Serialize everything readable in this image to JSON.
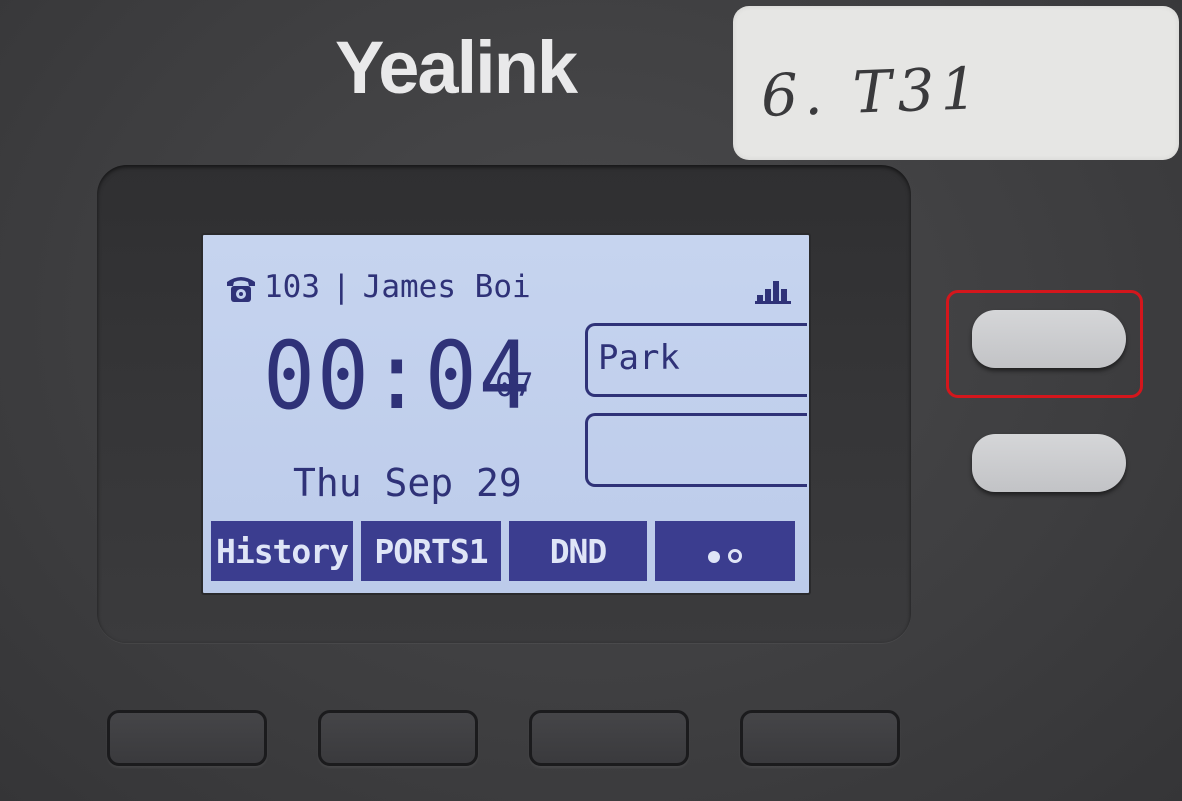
{
  "brand": {
    "logo_text": "Yealink"
  },
  "sticker": {
    "label": "6. T31"
  },
  "screen": {
    "status": {
      "phone_icon": "phone-icon",
      "line_number": "103",
      "separator": "|",
      "user_name": "James Boi",
      "signal_icon": "signal-icon"
    },
    "call_timer": "00:04",
    "call_timer_seconds": "07",
    "date": "Thu Sep 29",
    "line_keys": [
      {
        "label": "Park"
      },
      {
        "label": ""
      }
    ],
    "softkeys": [
      {
        "label": "History"
      },
      {
        "label": "PORTS1"
      },
      {
        "label": "DND"
      },
      {
        "label": "more",
        "icon": "more-dots-icon"
      }
    ]
  },
  "colors": {
    "lcd_background": "#bfcdeb",
    "lcd_text": "#2f3278",
    "softkey_background": "#3b3d8f",
    "highlight_outline": "#d4161c"
  }
}
